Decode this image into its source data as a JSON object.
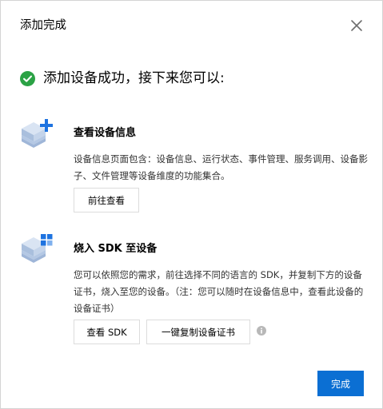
{
  "dialog": {
    "title": "添加完成",
    "close_icon": "close-icon"
  },
  "success": {
    "icon": "check-circle-icon",
    "message": "添加设备成功，接下来您可以:",
    "color": "#2ba245"
  },
  "steps": [
    {
      "icon": "device-cube-plus-icon",
      "title": "查看设备信息",
      "description": "设备信息页面包含：设备信息、运行状态、事件管理、服务调用、设备影子、文件管理等设备维度的功能集合。",
      "buttons": [
        "前往查看"
      ]
    },
    {
      "icon": "device-cube-grid-icon",
      "title": "烧入 SDK 至设备",
      "description": "您可以依照您的需求，前往选择不同的语言的 SDK，并复制下方的设备证书，烧入至您的设备。（注：您可以随时在设备信息中，查看此设备的设备证书）",
      "buttons": [
        "查看 SDK",
        "一键复制设备证书"
      ],
      "info_icon": "info-icon"
    }
  ],
  "footer": {
    "confirm_label": "完成"
  },
  "colors": {
    "primary": "#0b6fd3",
    "icon_blue": "#1e73e0",
    "icon_light": "#bfd4ef"
  }
}
